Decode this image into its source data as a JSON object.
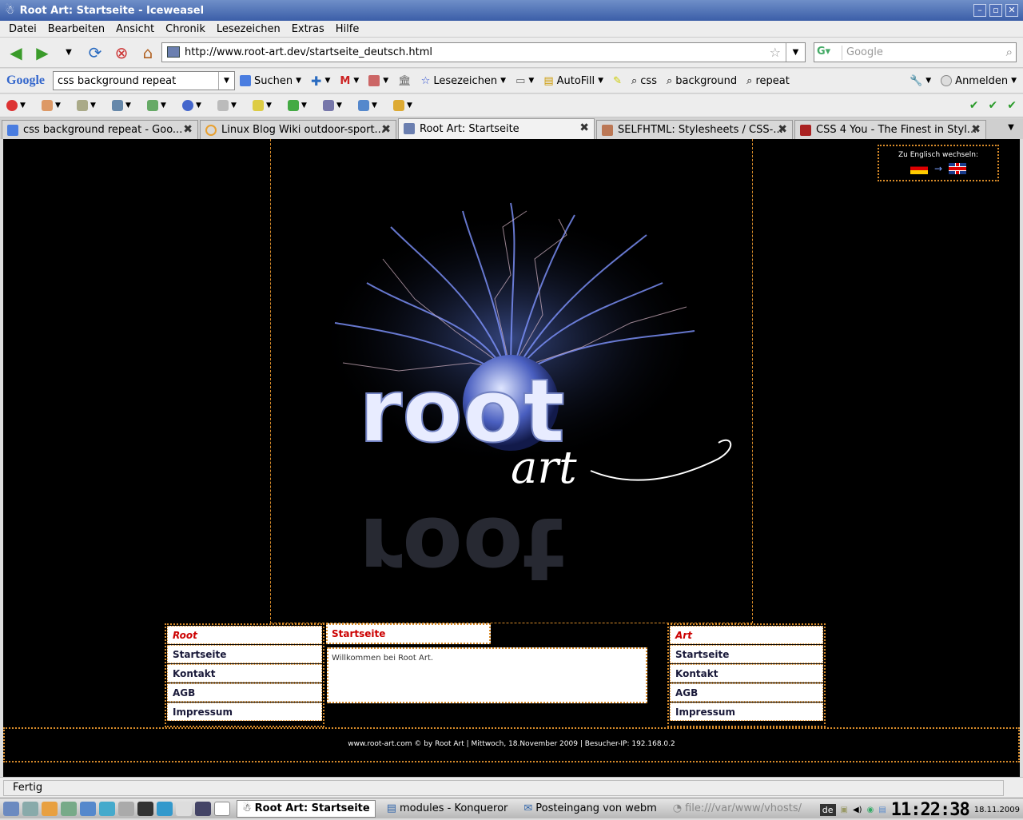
{
  "window": {
    "title": "Root Art: Startseite - Iceweasel"
  },
  "menu": [
    "Datei",
    "Bearbeiten",
    "Ansicht",
    "Chronik",
    "Lesezeichen",
    "Extras",
    "Hilfe"
  ],
  "nav": {
    "url": "http://www.root-art.dev/startseite_deutsch.html",
    "search_placeholder": "Google"
  },
  "google_toolbar": {
    "logo": "Google",
    "query": "css background repeat",
    "search_label": "Suchen",
    "bookmarks_label": "Lesezeichen",
    "autofill_label": "AutoFill",
    "terms": [
      "css",
      "background",
      "repeat"
    ],
    "signin_label": "Anmelden"
  },
  "tabs": [
    {
      "title": "css background repeat - Goo..."
    },
    {
      "title": "Linux Blog Wiki outdoor-sport..."
    },
    {
      "title": "Root Art: Startseite"
    },
    {
      "title": "SELFHTML: Stylesheets / CSS-..."
    },
    {
      "title": "CSS 4 You - The Finest in Styl..."
    }
  ],
  "page": {
    "lang_switch": "Zu Englisch wechseln:",
    "left_nav": [
      "Root",
      "Startseite",
      "Kontakt",
      "AGB",
      "Impressum"
    ],
    "right_nav": [
      "Art",
      "Startseite",
      "Kontakt",
      "AGB",
      "Impressum"
    ],
    "content_title": "Startseite",
    "content_text": "Willkommen bei Root Art.",
    "footer": "www.root-art.com © by  Root Art | Mittwoch, 18.November 2009 | Besucher-IP: 192.168.0.2"
  },
  "status": {
    "text": "Fertig"
  },
  "taskbar": {
    "tasks": [
      "Root Art: Startseite",
      "modules - Konqueror",
      "Posteingang von webm",
      "file:///var/www/vhosts/"
    ],
    "keyboard": "de",
    "clock": "11:22:38",
    "date": "18.11.2009"
  },
  "colors": {
    "accent_border": "#d98c2a",
    "nav_head": "#c00000",
    "background": "#000000"
  }
}
